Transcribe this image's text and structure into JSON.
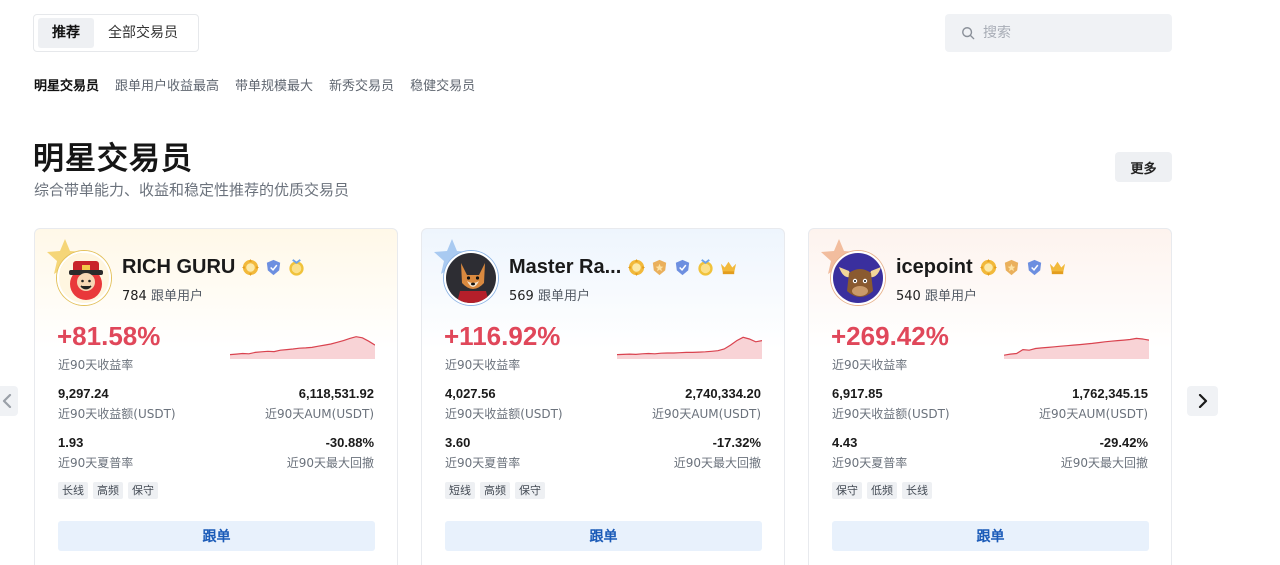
{
  "top_tabs": [
    "推荐",
    "全部交易员"
  ],
  "search": {
    "placeholder": "搜索"
  },
  "categories": [
    "明星交易员",
    "跟单用户收益最高",
    "带单规模最大",
    "新秀交易员",
    "稳健交易员"
  ],
  "section": {
    "title": "明星交易员",
    "subtitle": "综合带单能力、收益和稳定性推荐的优质交易员",
    "more_label": "更多"
  },
  "labels": {
    "followers_suffix": "跟单用户",
    "roi_label": "近90天收益率",
    "pnl_label": "近90天收益额(USDT)",
    "aum_label": "近90天AUM(USDT)",
    "sharpe_label": "近90天夏普率",
    "mdd_label": "近90天最大回撤",
    "follow_button": "跟单"
  },
  "colors": {
    "roi_positive": "#e0475a",
    "accent_blue": "#1b5bb8",
    "sparkline": "#d9434f"
  },
  "traders": [
    {
      "name": "RICH GURU",
      "followers": "784",
      "roi": "+81.58%",
      "pnl": "9,297.24",
      "aum": "6,118,531.92",
      "sharpe": "1.93",
      "mdd": "-30.88%",
      "tags": [
        "长线",
        "高频",
        "保守"
      ],
      "medals": [
        "gear-medal-icon",
        "shield-medal-icon",
        "coin-medal-icon"
      ],
      "avatar": "god-of-wealth-avatar",
      "sparkline": [
        0.12,
        0.14,
        0.16,
        0.15,
        0.2,
        0.22,
        0.24,
        0.23,
        0.28,
        0.3,
        0.32,
        0.35,
        0.36,
        0.38,
        0.42,
        0.46,
        0.5,
        0.56,
        0.62,
        0.7,
        0.76,
        0.72,
        0.6,
        0.46
      ]
    },
    {
      "name": "Master Ra...",
      "followers": "569",
      "roi": "+116.92%",
      "pnl": "4,027.56",
      "aum": "2,740,334.20",
      "sharpe": "3.60",
      "mdd": "-17.32%",
      "tags": [
        "短线",
        "高频",
        "保守"
      ],
      "medals": [
        "gear-medal-icon",
        "star-medal-icon",
        "shield-medal-icon",
        "coin-medal-icon",
        "crown-medal-icon"
      ],
      "avatar": "wolf-avatar",
      "sparkline": [
        0.12,
        0.13,
        0.14,
        0.13,
        0.15,
        0.16,
        0.15,
        0.17,
        0.18,
        0.18,
        0.19,
        0.2,
        0.2,
        0.21,
        0.22,
        0.24,
        0.26,
        0.32,
        0.46,
        0.62,
        0.74,
        0.68,
        0.58,
        0.62
      ]
    },
    {
      "name": "icepoint",
      "followers": "540",
      "roi": "+269.42%",
      "pnl": "6,917.85",
      "aum": "1,762,345.15",
      "sharpe": "4.43",
      "mdd": "-29.42%",
      "tags": [
        "保守",
        "低频",
        "长线"
      ],
      "medals": [
        "gear-medal-icon",
        "star-medal-icon",
        "shield-medal-icon",
        "crown-medal-icon"
      ],
      "avatar": "bull-avatar",
      "sparkline": [
        0.1,
        0.14,
        0.16,
        0.3,
        0.28,
        0.34,
        0.36,
        0.38,
        0.4,
        0.42,
        0.44,
        0.46,
        0.48,
        0.5,
        0.52,
        0.55,
        0.58,
        0.6,
        0.62,
        0.64,
        0.66,
        0.7,
        0.68,
        0.64
      ]
    }
  ]
}
